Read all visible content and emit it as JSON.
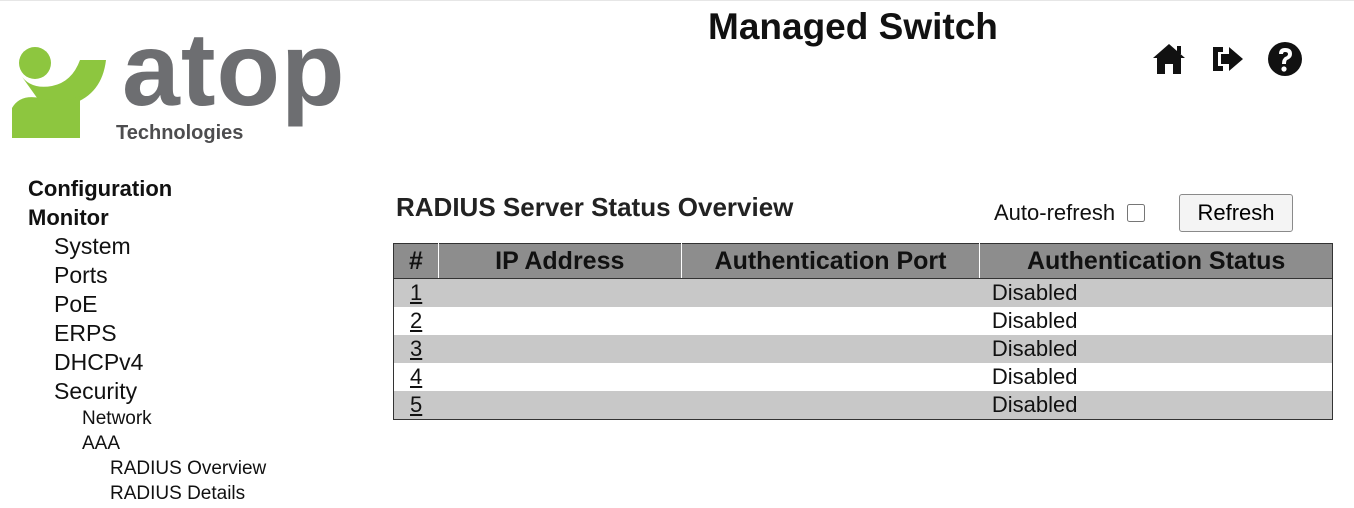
{
  "header": {
    "logo_word": "atop",
    "logo_sub": "Technologies",
    "title": "Managed Switch",
    "icons": [
      "home-icon",
      "logout-icon",
      "help-icon"
    ]
  },
  "nav": {
    "items": [
      {
        "label": "Configuration",
        "level": 0
      },
      {
        "label": "Monitor",
        "level": 0
      },
      {
        "label": "System",
        "level": 1
      },
      {
        "label": "Ports",
        "level": 1
      },
      {
        "label": "PoE",
        "level": 1
      },
      {
        "label": "ERPS",
        "level": 1
      },
      {
        "label": "DHCPv4",
        "level": 1
      },
      {
        "label": "Security",
        "level": 1
      },
      {
        "label": "Network",
        "level": 2
      },
      {
        "label": "AAA",
        "level": 2
      },
      {
        "label": "RADIUS Overview",
        "level": 3
      },
      {
        "label": "RADIUS Details",
        "level": 3
      }
    ]
  },
  "main": {
    "section_title": "RADIUS Server Status Overview",
    "auto_refresh_label": "Auto-refresh",
    "auto_refresh_checked": false,
    "refresh_label": "Refresh",
    "table": {
      "headers": [
        "#",
        "IP Address",
        "Authentication Port",
        "Authentication Status"
      ],
      "rows": [
        {
          "num": "1",
          "ip": "",
          "port": "",
          "status": "Disabled"
        },
        {
          "num": "2",
          "ip": "",
          "port": "",
          "status": "Disabled"
        },
        {
          "num": "3",
          "ip": "",
          "port": "",
          "status": "Disabled"
        },
        {
          "num": "4",
          "ip": "",
          "port": "",
          "status": "Disabled"
        },
        {
          "num": "5",
          "ip": "",
          "port": "",
          "status": "Disabled"
        }
      ]
    }
  },
  "colors": {
    "logo_green": "#8dc63f",
    "logo_gray": "#6d6e71",
    "header_bg": "#8d8d8d",
    "row_odd": "#c8c8c8"
  }
}
